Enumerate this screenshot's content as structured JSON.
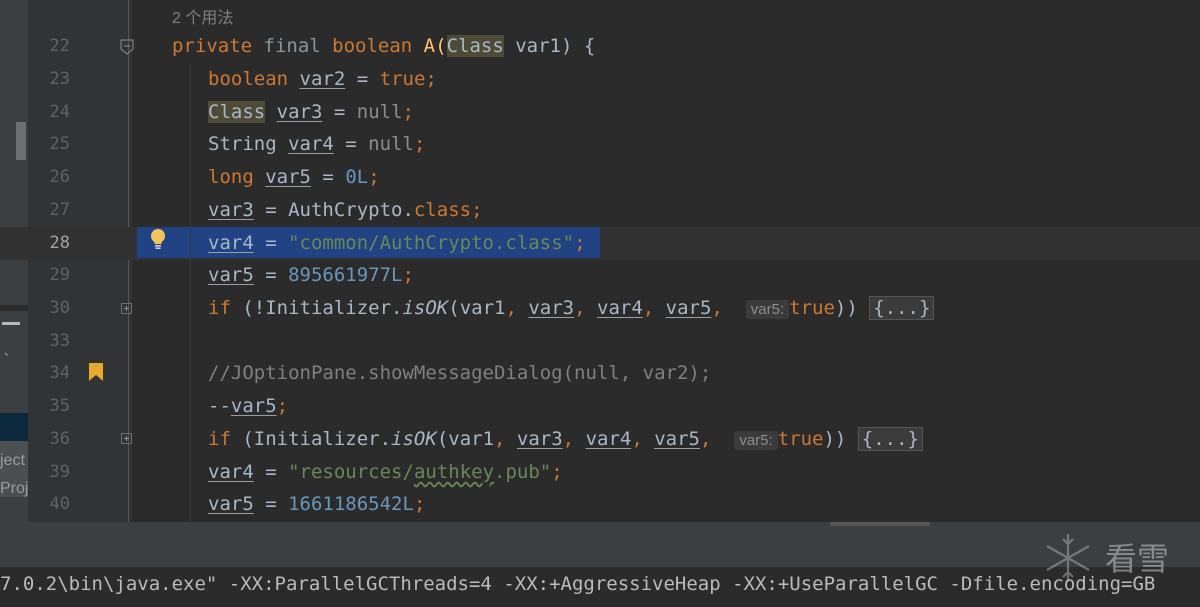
{
  "editor": {
    "usage_hint": "2 个用法",
    "lines": [
      {
        "num": "22"
      },
      {
        "num": "23"
      },
      {
        "num": "24"
      },
      {
        "num": "25"
      },
      {
        "num": "26"
      },
      {
        "num": "27"
      },
      {
        "num": "28"
      },
      {
        "num": "29"
      },
      {
        "num": "30"
      },
      {
        "num": "33"
      },
      {
        "num": "34"
      },
      {
        "num": "35"
      },
      {
        "num": "36"
      },
      {
        "num": "39"
      },
      {
        "num": "40"
      }
    ],
    "code": {
      "l22_a": "private",
      "l22_b": " final",
      "l22_c": " boolean",
      "l22_d": " A(",
      "l22_e": "Class",
      "l22_f": " var1) {",
      "l23_a": "boolean",
      "l23_b": "var2",
      "l23_c": " = ",
      "l23_d": "true",
      "l23_e": ";",
      "l24_a": "Class",
      "l24_b": "var3",
      "l24_c": " = ",
      "l24_d": "null",
      "l24_e": ";",
      "l25_a": "String ",
      "l25_b": "var4",
      "l25_c": " = ",
      "l25_d": "null",
      "l25_e": ";",
      "l26_a": "long",
      "l26_b": "var5",
      "l26_c": " = ",
      "l26_d": "0L",
      "l26_e": ";",
      "l27_a": "var3",
      "l27_b": " = AuthCrypto.",
      "l27_c": "class",
      "l27_d": ";",
      "l28_a": "var4",
      "l28_b": " = ",
      "l28_c": "\"common/AuthCrypto.class\"",
      "l28_d": ";",
      "l29_a": "var5",
      "l29_b": " = ",
      "l29_c": "895661977L",
      "l29_d": ";",
      "l30_a": "if",
      "l30_b": " (!Initializer.",
      "l30_c": "isOK",
      "l30_d": "(var1",
      "l30_e": ", ",
      "l30_f": "var3",
      "l30_g": ", ",
      "l30_h": "var4",
      "l30_i": ", ",
      "l30_j": "var5",
      "l30_k": ", ",
      "l30_hint": "var5:",
      "l30_l": "true",
      "l30_m": ")) ",
      "l30_fold": "{...}",
      "l34": "//JOptionPane.showMessageDialog(null, var2);",
      "l35_a": "--",
      "l35_b": "var5",
      "l35_c": ";",
      "l36_a": "if",
      "l36_b": " (Initializer.",
      "l36_c": "isOK",
      "l36_d": "(var1",
      "l36_e": ", ",
      "l36_f": "var3",
      "l36_g": ", ",
      "l36_h": "var4",
      "l36_i": ", ",
      "l36_j": "var5",
      "l36_k": ", ",
      "l36_hint": "var5:",
      "l36_l": "true",
      "l36_m": ")) ",
      "l36_fold": "{...}",
      "l39_a": "var4",
      "l39_b": " = ",
      "l39_c": "\"resources/",
      "l39_d": "authkey",
      "l39_e": ".pub\"",
      "l39_f": ";",
      "l40_a": "var5",
      "l40_b": " = ",
      "l40_c": "1661186542L",
      "l40_d": ";"
    }
  },
  "left_panel": {
    "text1": "ject",
    "text2": "Proj",
    "mark": "、"
  },
  "console": {
    "text": "7.0.2\\bin\\java.exe\" -XX:ParallelGCThreads=4 -XX:+AggressiveHeap -XX:+UseParallelGC -Dfile.encoding=GB"
  },
  "watermark": {
    "text": "看雪"
  },
  "colors": {
    "background": "#2b2b2b",
    "keyword": "#cc7832",
    "string": "#6a8759",
    "number": "#6897bb",
    "selection": "#214283"
  },
  "icons": [
    "fold-icon",
    "bookmark-icon",
    "lightbulb-icon"
  ]
}
